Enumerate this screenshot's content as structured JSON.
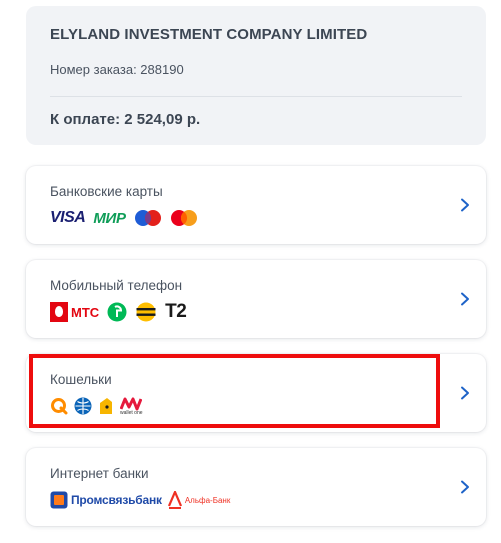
{
  "order": {
    "merchant": "ELYLAND INVESTMENT COMPANY LIMITED",
    "order_number": "Номер заказа: 288190",
    "amount": "К оплате: 2 524,09 р."
  },
  "methods": [
    {
      "title": "Банковские карты",
      "logos": [
        "VISA",
        "МИР",
        "Maestro",
        "Mastercard"
      ]
    },
    {
      "title": "Мобильный телефон",
      "logos": [
        "МТС",
        "МегаФон",
        "Билайн",
        "Т2"
      ]
    },
    {
      "title": "Кошельки",
      "logos": [
        "QIWI",
        "WebMoney",
        "Яндекс.Деньги",
        "wallet one"
      ]
    },
    {
      "title": "Интернет банки",
      "logos": [
        "Промсвязьбанк",
        "Альфа-Банк"
      ]
    }
  ],
  "colors": {
    "visa": "#1a1f71",
    "mir": "#0f9d58",
    "maestro_blue": "#1e5cd6",
    "maestro_red": "#e3211b",
    "mc_red": "#eb001b",
    "mc_orange": "#f79e1b",
    "mts": "#e30611",
    "megafon": "#00b956",
    "beeline": "#ffbe00",
    "qiwi": "#ff8c00",
    "webmoney": "#0a64b8",
    "yandex": "#f7b500",
    "psb": "#1f4aa8",
    "alfa": "#ef3124",
    "chevron": "#1e63c8",
    "highlight": "#ee0d0d"
  },
  "icons": [
    "chevron-right-icon"
  ]
}
